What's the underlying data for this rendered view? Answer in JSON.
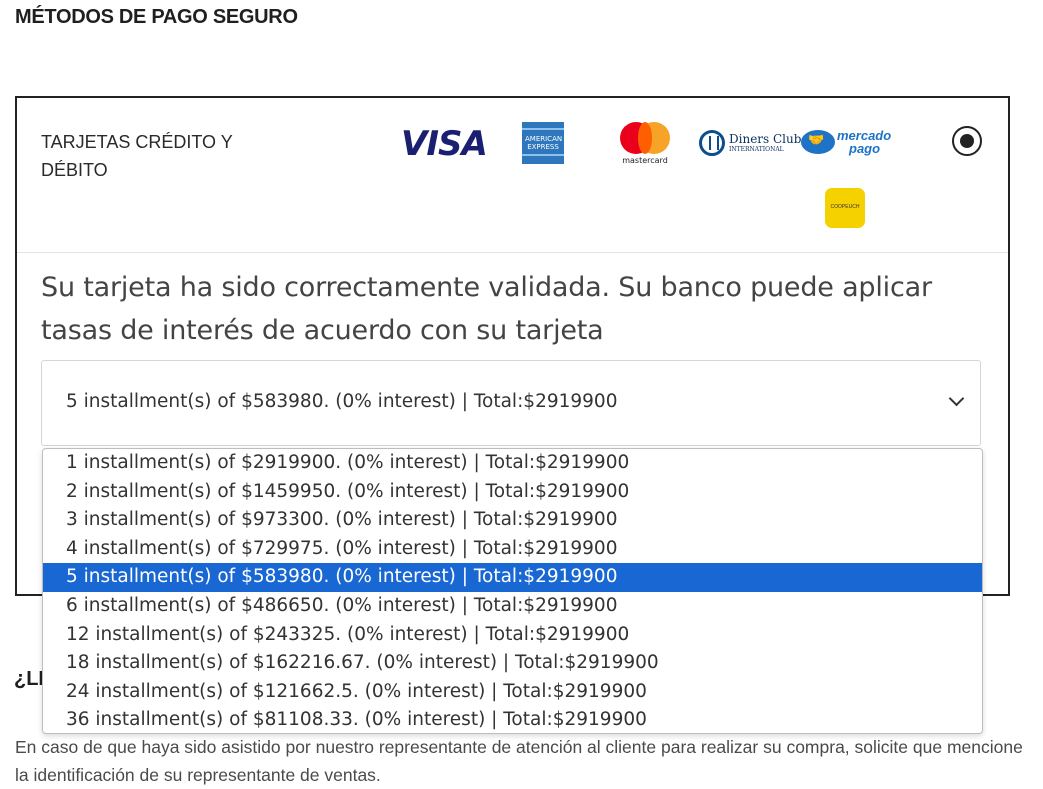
{
  "section": {
    "title": "MÉTODOS DE PAGO SEGURO"
  },
  "payment_method": {
    "label": "TARJETAS CRÉDITO Y DÉBITO",
    "selected": true,
    "logos": {
      "visa": "VISA",
      "amex": "AMERICAN EXPRESS",
      "mastercard": "mastercard",
      "diners_main": "Diners Club",
      "diners_sub": "INTERNATIONAL",
      "mercadopago_top": "mercado",
      "mercadopago_bottom": "pago",
      "coopeuch": "COOPEUCH"
    }
  },
  "validation_message": "Su tarjeta ha sido correctamente validada. Su banco puede aplicar tasas de interés de acuerdo con su tarjeta",
  "installments_select": {
    "value": "5 installment(s) of $583980. (0% interest) | Total:$2919900",
    "options": [
      "1 installment(s) of $2919900. (0% interest) | Total:$2919900",
      "2 installment(s) of $1459950. (0% interest) | Total:$2919900",
      "3 installment(s) of $973300. (0% interest) | Total:$2919900",
      "4 installment(s) of $729975. (0% interest) | Total:$2919900",
      "5 installment(s) of $583980. (0% interest) | Total:$2919900",
      "6 installment(s) of $486650. (0% interest) | Total:$2919900",
      "12 installment(s) of $243325. (0% interest) | Total:$2919900",
      "18 installment(s) of $162216.67. (0% interest) | Total:$2919900",
      "24 installment(s) of $121662.5. (0% interest) | Total:$2919900",
      "36 installment(s) of $81108.33. (0% interest) | Total:$2919900"
    ],
    "selected_index": 4
  },
  "faq_heading_partial": "¿LE",
  "info_text": "En caso de que haya sido asistido por nuestro representante de atención al cliente para realizar su compra, solicite que mencione la identificación de su representante de ventas.",
  "colors": {
    "selected_option": "#1967d2",
    "visa": "#1a1f71",
    "amex": "#2e77bc"
  }
}
